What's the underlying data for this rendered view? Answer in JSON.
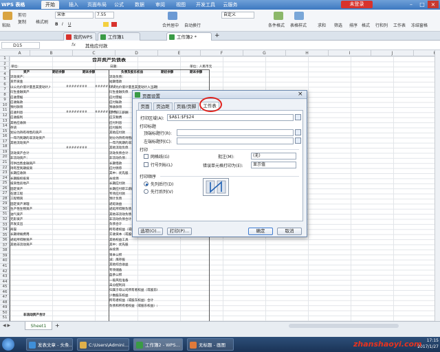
{
  "app": {
    "title": "WPS 表格"
  },
  "menu": {
    "tabs": [
      "开始",
      "插入",
      "页面布局",
      "公式",
      "数据",
      "审阅",
      "视图",
      "开发工具",
      "云服务"
    ],
    "login": "未登录"
  },
  "ribbon": {
    "paste": "粘贴",
    "cut": "剪切",
    "copy": "复制",
    "format_painter": "格式刷",
    "font": "宋体",
    "font_size": "7.55",
    "number_format": "自定义",
    "merge": "合并居中",
    "wrap": "自动换行",
    "cond_format": "条件格式",
    "table_style": "表格样式",
    "sum": "求和",
    "filter": "筛选",
    "sort": "排序",
    "format": "格式",
    "row_col": "行和列",
    "sheet": "工作表",
    "freeze": "冻结窗格"
  },
  "doctabs": [
    {
      "label": "我的WPS"
    },
    {
      "label": "工作簿1"
    },
    {
      "label": "工作簿2 *"
    }
  ],
  "formula": {
    "cellref": "D15",
    "fx": "fx",
    "content": "其他应付款"
  },
  "columns": [
    "A",
    "B",
    "C",
    "D",
    "E",
    "F",
    "G",
    "H",
    "I",
    "J",
    "K"
  ],
  "rows": [
    "1",
    "2",
    "3",
    "4",
    "5",
    "6",
    "7",
    "8",
    "9",
    "10",
    "11",
    "12",
    "13",
    "14",
    "15",
    "16",
    "17",
    "18",
    "19",
    "20",
    "21",
    "22",
    "23",
    "24",
    "25",
    "26",
    "27",
    "28",
    "29",
    "30",
    "31",
    "32",
    "33",
    "34",
    "35",
    "36",
    "37",
    "38",
    "39",
    "40",
    "41",
    "42",
    "43",
    "44",
    "45",
    "46",
    "47",
    "48",
    "49",
    "50",
    "51"
  ],
  "sheet": {
    "title": "合并资产负债表",
    "unit_left": "单位:",
    "date": "日期:",
    "unit_right": "单位：人民币元",
    "headers": [
      "资产",
      "期初余额",
      "期末余额",
      "负债及股东权益",
      "期初余额",
      "期末余额"
    ],
    "left_items": [
      "流动资产：",
      "货币资金",
      "以公允价值计量且其变动计入当期损益的金融资产",
      "衍生金融资产",
      "应收票据",
      "应收账款",
      "预付款项",
      "应收利息",
      "应收股利",
      "其他应收款",
      "存货",
      "划分为持有待售的资产",
      "一年内到期的非流动资产",
      "其他流动资产",
      "",
      "流动资产合计",
      "非流动资产：",
      "可供出售金融资产",
      "持有至到期投资",
      "长期应收款",
      "长期股权投资",
      "投资性房地产",
      "固定资产",
      "在建工程",
      "工程物资",
      "固定资产清理",
      "生产性生物资产",
      "油气资产",
      "无形资产",
      "开发支出",
      "商誉",
      "长期待摊费用",
      "递延所得税资产",
      "其他非流动资产"
    ],
    "right_items": [
      "流动负债：",
      "短期借款",
      "以公允价值计量且其变动计入当期损益的金融负债",
      "衍生金融负债",
      "应付票据",
      "应付账款",
      "预收款项",
      "应付职工薪酬",
      "应交税费",
      "应付利息",
      "应付股利",
      "其他应付款",
      "划分为持有待售的负债",
      "一年内到期的非流动负债",
      "其他流动负债",
      "流动负债合计",
      "非流动负债：",
      "长期借款",
      "应付债券",
      "其中：优先股",
      "永续债",
      "长期应付款",
      "长期应付职工薪酬",
      "专项应付款",
      "预计负债",
      "递延收益",
      "递延所得税负债",
      "其他非流动负债",
      "非流动负债合计",
      "负债合计",
      "所有者权益（或股东权益）：",
      "实收资本（或股本）",
      "其他权益工具",
      "其中：优先股",
      "永续债",
      "资本公积",
      "减：库存股",
      "其他综合收益",
      "专项储备",
      "盈余公积",
      "一般风险准备",
      "未分配利润",
      "归属于母公司所有者权益（或股东权益）合计",
      "少数股东权益",
      "所有者权益（或股东权益）合计",
      "负债和所有者权益（或股东权益）总计"
    ],
    "hashes": "########",
    "nonflow_total": "非流动资产合计"
  },
  "dialog": {
    "title": "页面设置",
    "tabs": [
      "页面",
      "页边距",
      "页眉/页脚",
      "工作表"
    ],
    "print_area_label": "打印区域(A):",
    "print_area_value": "$A$1:$F$24",
    "print_titles_label": "打印标题",
    "top_rows_label": "顶端标题行(R):",
    "left_cols_label": "左端标题列(C):",
    "print_label": "打印",
    "gridlines_label": "网格线(G)",
    "rowcol_label": "行号列标(L)",
    "comments_label": "批注(M):",
    "comments_value": "(无)",
    "errors_label": "错误单元格打印为(E):",
    "errors_value": "显示值",
    "order_label": "打印顺序",
    "down_then_over": "先列后行(D)",
    "over_then_down": "先行后列(V)",
    "options_btn": "选项(O)...",
    "print_btn": "打印(P)...",
    "ok_btn": "确定",
    "cancel_btn": "取消"
  },
  "sheet_tabs": [
    "Sheet1"
  ],
  "taskbar": {
    "items": [
      "发表文章 - 头条...",
      "C:\\Users\\Admini...",
      "工作簿2 - WPS...",
      "无标题 - 画图"
    ],
    "time": "17:15",
    "date": "2017/1/27"
  },
  "watermark": "zhanshaoyi.com",
  "colors": {
    "accent": "#3d78c0",
    "tab_active": "#2f6b2f",
    "highlight": "#e0201a"
  }
}
